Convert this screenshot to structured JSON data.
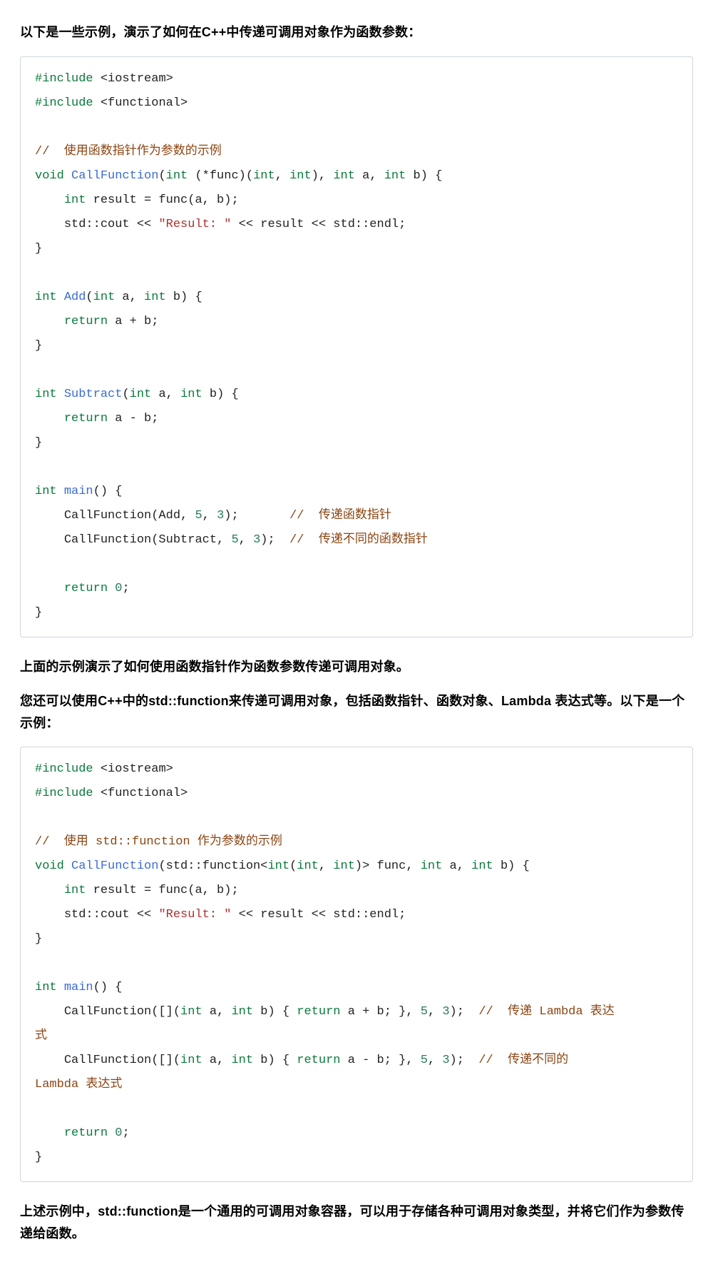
{
  "intro": "以下是一些示例，演示了如何在C++中传递可调用对象作为函数参数：",
  "code1": {
    "l1a": "#include",
    "l1b": "<iostream>",
    "l2a": "#include",
    "l2b": "<functional>",
    "c1": "//  使用函数指针作为参数的示例",
    "fn1": "CallFunction",
    "kvoid": "void",
    "kint": "int",
    "sig1a": "(*func)(",
    "sig1b": ")",
    "sig1c": " a, ",
    "sig1d": " b) {",
    "body1a": "    ",
    "body1b": " result = func(a, b);",
    "body1c": "    std::cout << ",
    "str1": "\"Result: \"",
    "body1d": " << result << std::endl;",
    "close": "}",
    "fn2": "Add",
    "add_sig": " a, ",
    "ret1": "return",
    "ret1_body": " a + b;",
    "fn3": "Subtract",
    "ret2_body": " a - b;",
    "main": "main",
    "main_sig": "() {",
    "call1": "    CallFunction(Add, ",
    "n5": "5",
    "n3": "3",
    "call1b": ");       ",
    "cm_call1": "//  传递函数指针",
    "call2": "    CallFunction(Subtract, ",
    "call2b": ");  ",
    "cm_call2": "//  传递不同的函数指针",
    "ret0": "    ",
    "kreturn": "return",
    "zero": "0",
    "semi": ";"
  },
  "para1": "上面的示例演示了如何使用函数指针作为函数参数传递可调用对象。",
  "para2": "您还可以使用C++中的std::function来传递可调用对象，包括函数指针、函数对象、Lambda 表达式等。以下是一个示例：",
  "code2": {
    "c1": "//  使用 std::function 作为参数的示例",
    "sig1": "(std::function<",
    "sig2": "(",
    "sig3": ", ",
    "sig4": ")> func, ",
    "call1_pre": "    CallFunction([](",
    "call1_mid": " a, ",
    "call1_mid2": " b) { ",
    "call1_ret": "return",
    "call1_body": " a + b; }, ",
    "call1_end": ");  ",
    "cm1": "//  传递 Lambda 表达式",
    "cm1_prefix": "//  传递 Lambda 表达",
    "cm1_wrap": "式",
    "call2_body": " a - b; }, ",
    "cm2_prefix": "//  传递不同的",
    "cm2_wrap": "Lambda 表达式"
  },
  "outro": "上述示例中，std::function是一个通用的可调用对象容器，可以用于存储各种可调用对象类型，并将它们作为参数传递给函数。"
}
